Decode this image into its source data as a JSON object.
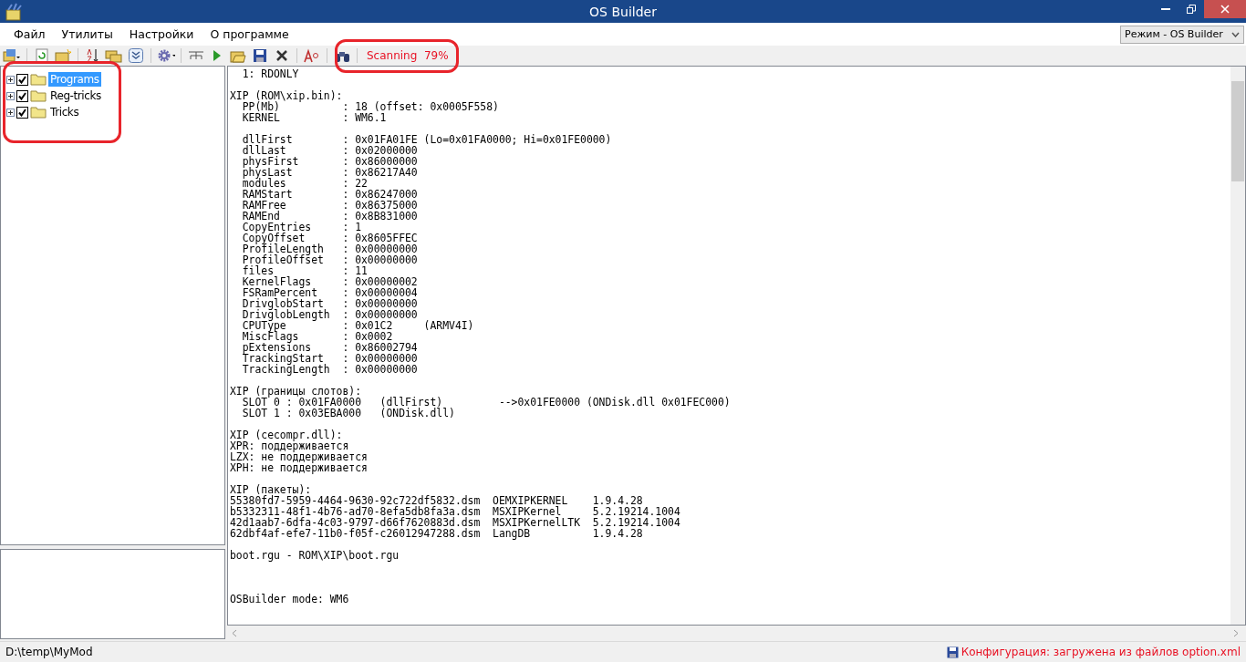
{
  "window": {
    "title": "OS Builder"
  },
  "menu": [
    {
      "label": "Файл"
    },
    {
      "label": "Утилиты"
    },
    {
      "label": "Настройки"
    },
    {
      "label": "О программе"
    }
  ],
  "mode_select": {
    "value": "Режим - OS Builder"
  },
  "scan_status": {
    "text": "Scanning  79%",
    "highlighted": true
  },
  "tree": {
    "highlighted": true,
    "items": [
      {
        "label": "Programs",
        "checked": true,
        "selected": true,
        "expanded": false
      },
      {
        "label": "Reg-tricks",
        "checked": true,
        "selected": false,
        "expanded": false
      },
      {
        "label": "Tricks",
        "checked": true,
        "selected": false,
        "expanded": false
      }
    ]
  },
  "log": {
    "blocks": [
      {
        "kind": "near",
        "lines": [
          "  1: RDONLY"
        ]
      },
      {
        "kind": "near",
        "lines": [
          "XIP (ROM\\xip.bin):",
          "  PP(Mb)          : 18 (offset: 0x0005F558)",
          "  KERNEL          : WM6.1"
        ]
      },
      {
        "kind": "near",
        "lines": [
          "  dllFirst        : 0x01FA01FE (Lo=0x01FA0000; Hi=0x01FE0000)",
          "  dllLast         : 0x02000000",
          "  physFirst       : 0x86000000",
          "  physLast        : 0x86217A40",
          "  modules         : 22",
          "  RAMStart        : 0x86247000",
          "  RAMFree         : 0x86375000",
          "  RAMEnd          : 0x8B831000",
          "  CopyEntries     : 1",
          "  CopyOffset      : 0x8605FFEC",
          "  ProfileLength   : 0x00000000",
          "  ProfileOffset   : 0x00000000",
          "  files           : 11",
          "  KernelFlags     : 0x00000002",
          "  FSRamPercent    : 0x00000004",
          "  DrivglobStart   : 0x00000000",
          "  DrivglobLength  : 0x00000000",
          "  CPUType         : 0x01C2     (ARMV4I)",
          "  MiscFlags       : 0x0002",
          "  pExtensions     : 0x86002794",
          "  TrackingStart   : 0x00000000",
          "  TrackingLength  : 0x00000000"
        ]
      },
      {
        "kind": "near",
        "lines": [
          "XIP (границы слотов):",
          "  SLOT 0 : 0x01FA0000   (dllFirst)         -->0x01FE0000 (ONDisk.dll 0x01FEC000)",
          "  SLOT 1 : 0x03EBA000   (ONDisk.dll)"
        ]
      },
      {
        "kind": "near",
        "lines": [
          "XIP (cecompr.dll):",
          "XPR: поддерживается",
          "LZX: не поддерживается",
          "XPH: не поддерживается"
        ]
      },
      {
        "kind": "near",
        "lines": [
          "XIP (пакеты):",
          "55380fd7-5959-4464-9630-92c722df5832.dsm  OEMXIPKERNEL    1.9.4.28",
          "b5332311-48f1-4b76-ad70-8efa5db8fa3a.dsm  MSXIPKernel     5.2.19214.1004",
          "42d1aab7-6dfa-4c03-9797-d66f7620883d.dsm  MSXIPKernelLTK  5.2.19214.1004",
          "62dbf4af-efe7-11b0-f05f-c26012947288.dsm  LangDB          1.9.4.28"
        ]
      },
      {
        "kind": "near",
        "lines": [
          "boot.rgu - ROM\\XIP\\boot.rgu"
        ]
      },
      {
        "kind": "far",
        "lines": [
          "OSBuilder mode: WM6"
        ]
      }
    ]
  },
  "status_bar": {
    "path": "D:\\temp\\MyMod",
    "config": "Конфигурация: загружена из файлов option.xml"
  }
}
